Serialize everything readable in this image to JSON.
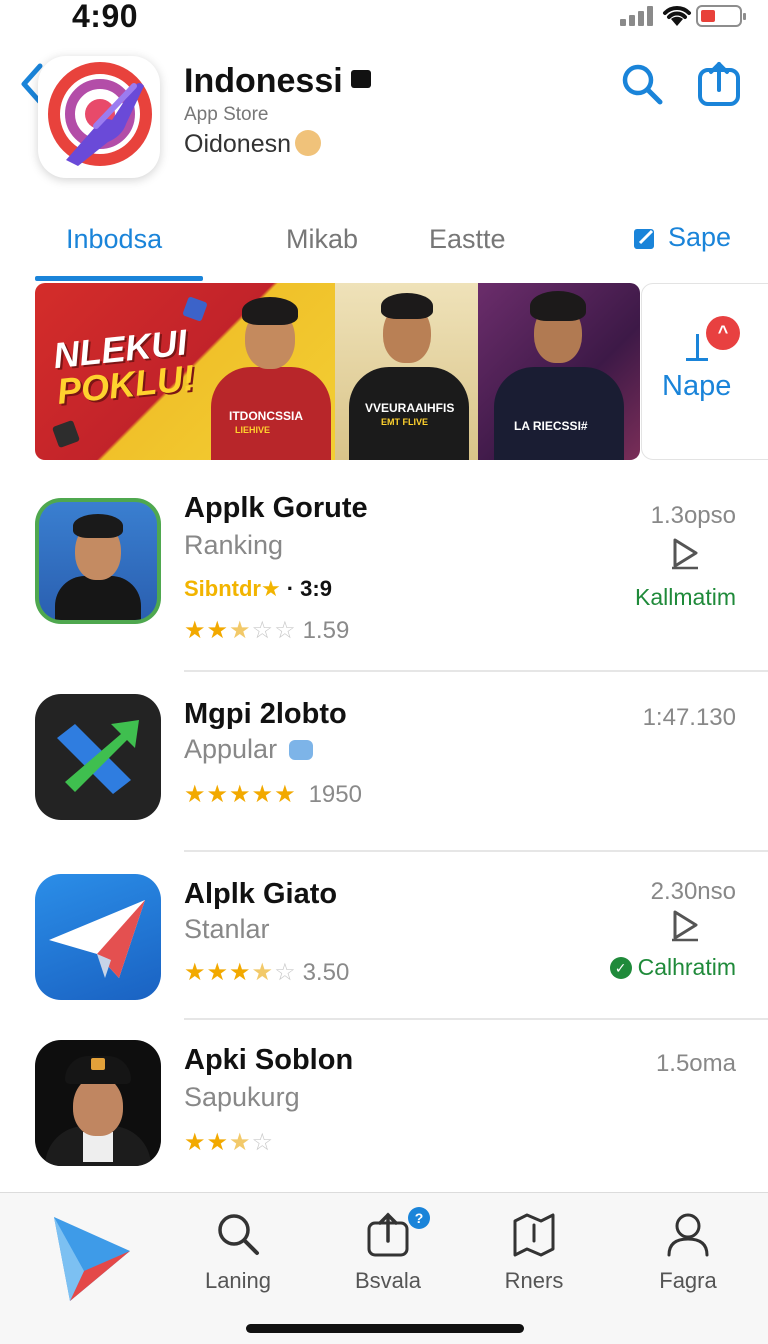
{
  "status_bar": {
    "time": "4:90"
  },
  "header": {
    "title": "Indonessi",
    "store_label": "App Store",
    "subtitle": "Oidonesn",
    "back_icon": "chevron-left-icon",
    "search_icon": "search-icon",
    "share_icon": "share-icon"
  },
  "tabs": [
    {
      "label": "Inbodsa",
      "active": true
    },
    {
      "label": "Mikab",
      "active": false
    },
    {
      "label": "Eastte",
      "active": false
    }
  ],
  "save_tab": {
    "label": "Sape"
  },
  "banner": {
    "headline_line1": "NLEKUI",
    "headline_line2": "POKLU!",
    "shirt1": "ITDONCSSIA",
    "shirt1_sub": "LIEHIVE",
    "shirt2": "VVEURAAIHFIS",
    "shirt2_sub": "EMT FLIVE",
    "shirt3": "LA RIECSSI#"
  },
  "side_card": {
    "label": "Nape",
    "badge": "^"
  },
  "apps": [
    {
      "name": "Applk Gorute",
      "category": "Ranking",
      "size": "1.3opso",
      "subline_yellow": "Sibntdr★",
      "subline_value": "· 3:9",
      "stars_full": 2,
      "stars_half": 1,
      "reviews": "1.59",
      "action": "Kallmatim"
    },
    {
      "name": "Mgpi 2lobto",
      "category": "Appular",
      "size": "1:47.130",
      "stars_full": 5,
      "stars_half": 0,
      "reviews": "1950",
      "action": ""
    },
    {
      "name": "Alplk Giato",
      "category": "Stanlar",
      "size": "2.30nso",
      "stars_full": 3,
      "stars_half": 1,
      "reviews": "3.50",
      "action": "Calhratim"
    },
    {
      "name": "Apki Soblon",
      "category": "Sapukurg",
      "size": "1.5oma",
      "stars_full": 2,
      "stars_half": 1,
      "reviews": "",
      "action": ""
    }
  ],
  "tab_bar": [
    {
      "label": "",
      "icon": "app-store-logo-icon"
    },
    {
      "label": "Laning",
      "icon": "search-icon"
    },
    {
      "label": "Bsvala",
      "icon": "share-icon",
      "badge": "?"
    },
    {
      "label": "Rners",
      "icon": "map-icon"
    },
    {
      "label": "Fagra",
      "icon": "person-icon"
    }
  ],
  "colors": {
    "accent": "#1a84d9",
    "action_green": "#1f8a3a",
    "star": "#f2a900"
  }
}
